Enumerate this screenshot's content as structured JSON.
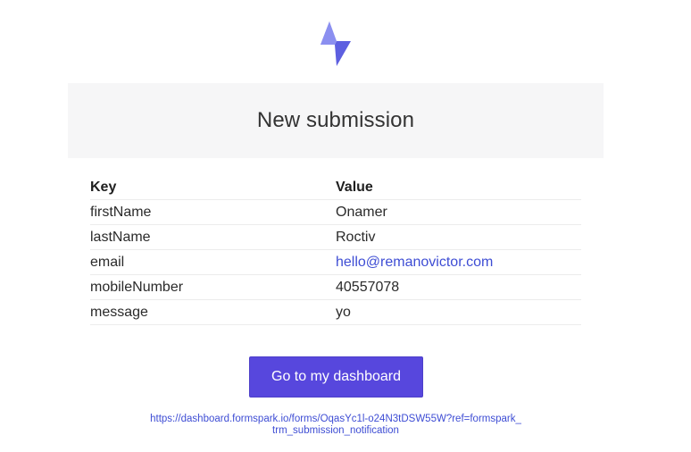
{
  "logo": {
    "icon": "lightning-bolt-icon",
    "colors": [
      "#8f95f0",
      "#5d5fe0"
    ]
  },
  "header": {
    "title": "New submission",
    "background": "#f6f6f7"
  },
  "table": {
    "columns": [
      "Key",
      "Value"
    ],
    "rows": [
      {
        "key": "firstName",
        "value": "Onamer"
      },
      {
        "key": "lastName",
        "value": "Roctiv"
      },
      {
        "key": "email",
        "value": "hello@remanovictor.com"
      },
      {
        "key": "mobileNumber",
        "value": "40557078"
      },
      {
        "key": "message",
        "value": "yo"
      }
    ]
  },
  "actions": {
    "dashboard_button_label": "Go to my dashboard",
    "button_color": "#5747dd",
    "dashboard_url_line1": "https://dashboard.formspark.io/forms/OqasYc1l-o24N3tDSW55W?ref=formspark_",
    "dashboard_url_line2": "trm_submission_notification",
    "link_color": "#3e4dd4"
  }
}
